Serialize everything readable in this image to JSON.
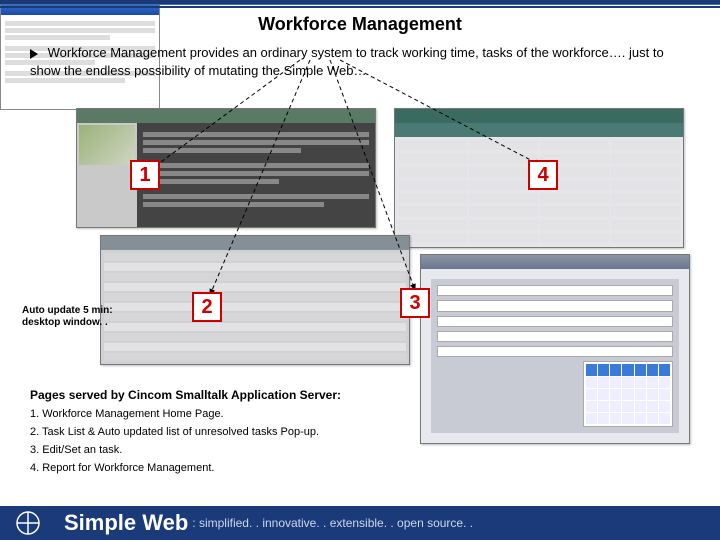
{
  "title": "Workforce Management",
  "intro": "Workforce Management provides an ordinary system to track working time, tasks of the workforce…. just to show the endless possibility of mutating the Simple Web…",
  "labels": {
    "n1": "1",
    "n2": "2",
    "n3": "3",
    "n4": "4"
  },
  "popup_caption_line1": "Auto update 5 min:",
  "popup_caption_line2": "desktop window. .",
  "served": {
    "header": "Pages served by Cincom Smalltalk Application Server:",
    "items": [
      "1. Workforce Management Home Page.",
      "2. Task List & Auto updated list of unresolved tasks Pop-up.",
      "3. Edit/Set an task.",
      "4. Report for Workforce Management."
    ]
  },
  "footer": {
    "brand": "Simple Web",
    "tagline": ": simplified. . innovative. . extensible. . open source. ."
  },
  "screens": {
    "s1": "Workforce Management Home Page",
    "s2": "Task List",
    "s3": "Edit/Set task form",
    "s4": "Reports",
    "popup": "Auto-updated tasks popup"
  }
}
